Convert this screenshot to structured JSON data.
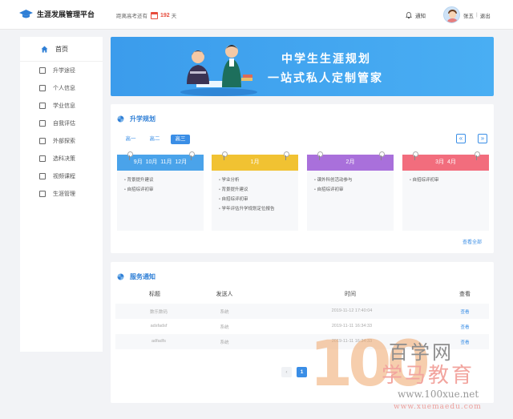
{
  "header": {
    "app_title": "生涯发展管理平台",
    "countdown_label": "距离高考还有",
    "days": "192",
    "days_unit": "天",
    "notify_label": "通知",
    "user_name": "张五",
    "logout_label": "退出"
  },
  "sidebar": {
    "home": "首页",
    "items": [
      {
        "label": "升学途径",
        "icon": "chart-icon"
      },
      {
        "label": "个人信息",
        "icon": "id-card-icon"
      },
      {
        "label": "学业信息",
        "icon": "document-icon"
      },
      {
        "label": "自我评估",
        "icon": "clipboard-icon"
      },
      {
        "label": "外部探索",
        "icon": "book-icon"
      },
      {
        "label": "选科决策",
        "icon": "magnifier-icon"
      },
      {
        "label": "视频课程",
        "icon": "video-icon"
      },
      {
        "label": "生涯管理",
        "icon": "user-icon"
      }
    ]
  },
  "banner": {
    "line1": "中学生生涯规划",
    "line2": "一站式私人定制管家"
  },
  "planning": {
    "title": "升学规划",
    "grades": [
      "高一",
      "高二",
      "高三"
    ],
    "active_grade": "高三",
    "prev": "«",
    "next": "»",
    "view_all": "查看全部",
    "months": [
      {
        "title": "9月  10月  11月  12月",
        "color": "#4aa3ea",
        "items": [
          "背景提升建议",
          "自招综评初审"
        ]
      },
      {
        "title": "1月",
        "color": "#f1c232",
        "items": [
          "学业分析",
          "背景提升建议",
          "自招综评初审",
          "学年评估升学规划定位报告"
        ]
      },
      {
        "title": "2月",
        "color": "#a970db",
        "items": [
          "课外科创活动参与",
          "自招综评初审"
        ]
      },
      {
        "title": "3月  4月",
        "color": "#f26d7d",
        "items": [
          "自招综评初审"
        ]
      }
    ]
  },
  "notices": {
    "title": "服务通知",
    "columns": [
      "标题",
      "发送人",
      "时间",
      "查看"
    ],
    "rows": [
      {
        "title": "数乐数码",
        "sender": "系统",
        "time": "2019-11-12 17:40:04",
        "view": "查看"
      },
      {
        "title": "adsfadsf",
        "sender": "系统",
        "time": "2019-11-11 16:34:33",
        "view": "查看"
      },
      {
        "title": "adfadfs",
        "sender": "系统",
        "time": "2019-11-11 16:34:33",
        "view": "查看"
      }
    ],
    "pager": {
      "prev": "‹",
      "current": "1"
    }
  },
  "watermark": {
    "number": "100",
    "text1": "百学网",
    "text2": "学马教育",
    "url1": "www.100xue.net",
    "url2": "www.xuemaedu.com"
  },
  "colors": {
    "accent": "#3a8ee6",
    "days": "#e74c3c"
  }
}
